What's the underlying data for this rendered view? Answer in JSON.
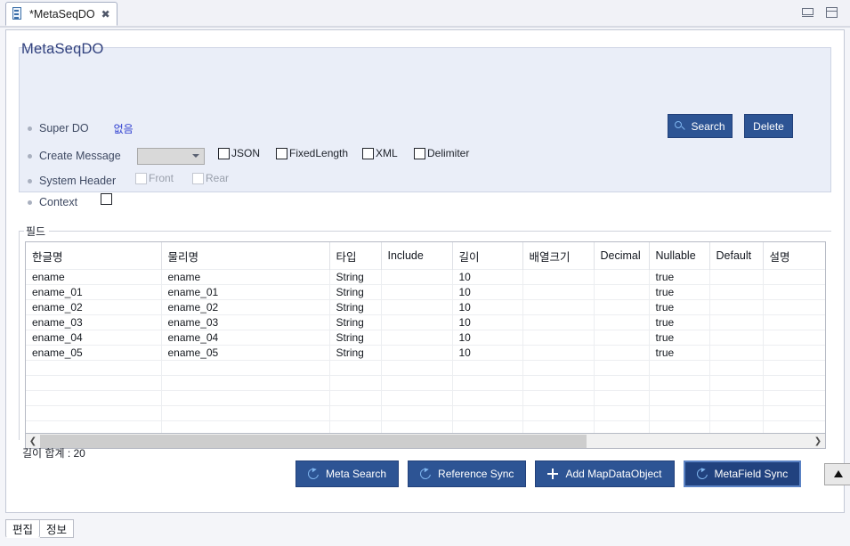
{
  "window": {
    "tab": {
      "label": "*MetaSeqDO",
      "icon": "document-icon",
      "close_glyph": "✖"
    },
    "controls": {
      "minimize": "minimize",
      "maximize": "maximize"
    }
  },
  "header": {
    "title": "MetaSeqDO",
    "fields": {
      "super_do_label": "Super DO",
      "super_do_value": "없음",
      "create_message_label": "Create Message",
      "create_message_value": "",
      "system_header_label": "System Header",
      "context_label": "Context"
    },
    "checkboxes": [
      {
        "name": "json",
        "label": "JSON",
        "checked": false,
        "disabled": false
      },
      {
        "name": "fixedlength",
        "label": "FixedLength",
        "checked": false,
        "disabled": false
      },
      {
        "name": "xml",
        "label": "XML",
        "checked": false,
        "disabled": false
      },
      {
        "name": "delimiter",
        "label": "Delimiter",
        "checked": false,
        "disabled": false
      },
      {
        "name": "front",
        "label": "Front",
        "checked": false,
        "disabled": true
      },
      {
        "name": "rear",
        "label": "Rear",
        "checked": false,
        "disabled": true
      },
      {
        "name": "context",
        "label": "",
        "checked": false,
        "disabled": false
      }
    ],
    "buttons": {
      "search": "Search",
      "delete": "Delete"
    }
  },
  "field_group": {
    "legend": "필드",
    "columns": [
      "한글명",
      "물리명",
      "타입",
      "Include",
      "길이",
      "배열크기",
      "Decimal",
      "Nullable",
      "Default",
      "설명"
    ],
    "rows": [
      {
        "korean_name": "ename",
        "physical_name": "ename",
        "type": "String",
        "include": "",
        "length": "10",
        "array_size": "",
        "decimal": "",
        "nullable": "true",
        "default": "",
        "description": ""
      },
      {
        "korean_name": "ename_01",
        "physical_name": "ename_01",
        "type": "String",
        "include": "",
        "length": "10",
        "array_size": "",
        "decimal": "",
        "nullable": "true",
        "default": "",
        "description": ""
      },
      {
        "korean_name": "ename_02",
        "physical_name": "ename_02",
        "type": "String",
        "include": "",
        "length": "10",
        "array_size": "",
        "decimal": "",
        "nullable": "true",
        "default": "",
        "description": ""
      },
      {
        "korean_name": "ename_03",
        "physical_name": "ename_03",
        "type": "String",
        "include": "",
        "length": "10",
        "array_size": "",
        "decimal": "",
        "nullable": "true",
        "default": "",
        "description": ""
      },
      {
        "korean_name": "ename_04",
        "physical_name": "ename_04",
        "type": "String",
        "include": "",
        "length": "10",
        "array_size": "",
        "decimal": "",
        "nullable": "true",
        "default": "",
        "description": ""
      },
      {
        "korean_name": "ename_05",
        "physical_name": "ename_05",
        "type": "String",
        "include": "",
        "length": "10",
        "array_size": "",
        "decimal": "",
        "nullable": "true",
        "default": "",
        "description": ""
      }
    ],
    "empty_row_count": 5,
    "scroll": {
      "left_glyph": "❮",
      "right_glyph": "❯"
    }
  },
  "status": {
    "length_total": "길이 합계 : 20"
  },
  "toolbar": {
    "meta_search": "Meta Search",
    "reference_sync": "Reference Sync",
    "add_map_data_object": "Add MapDataObject",
    "metafield_sync": "MetaField Sync",
    "move_up": "▲",
    "move_down": "▼"
  },
  "bottom_tabs": [
    {
      "label": "편집",
      "selected": true
    },
    {
      "label": "정보",
      "selected": false
    }
  ],
  "colors": {
    "accent_blue": "#2d5494",
    "panel_bg": "#eaeef8",
    "title_color": "#31417e",
    "link_color": "#2f3fd0"
  }
}
